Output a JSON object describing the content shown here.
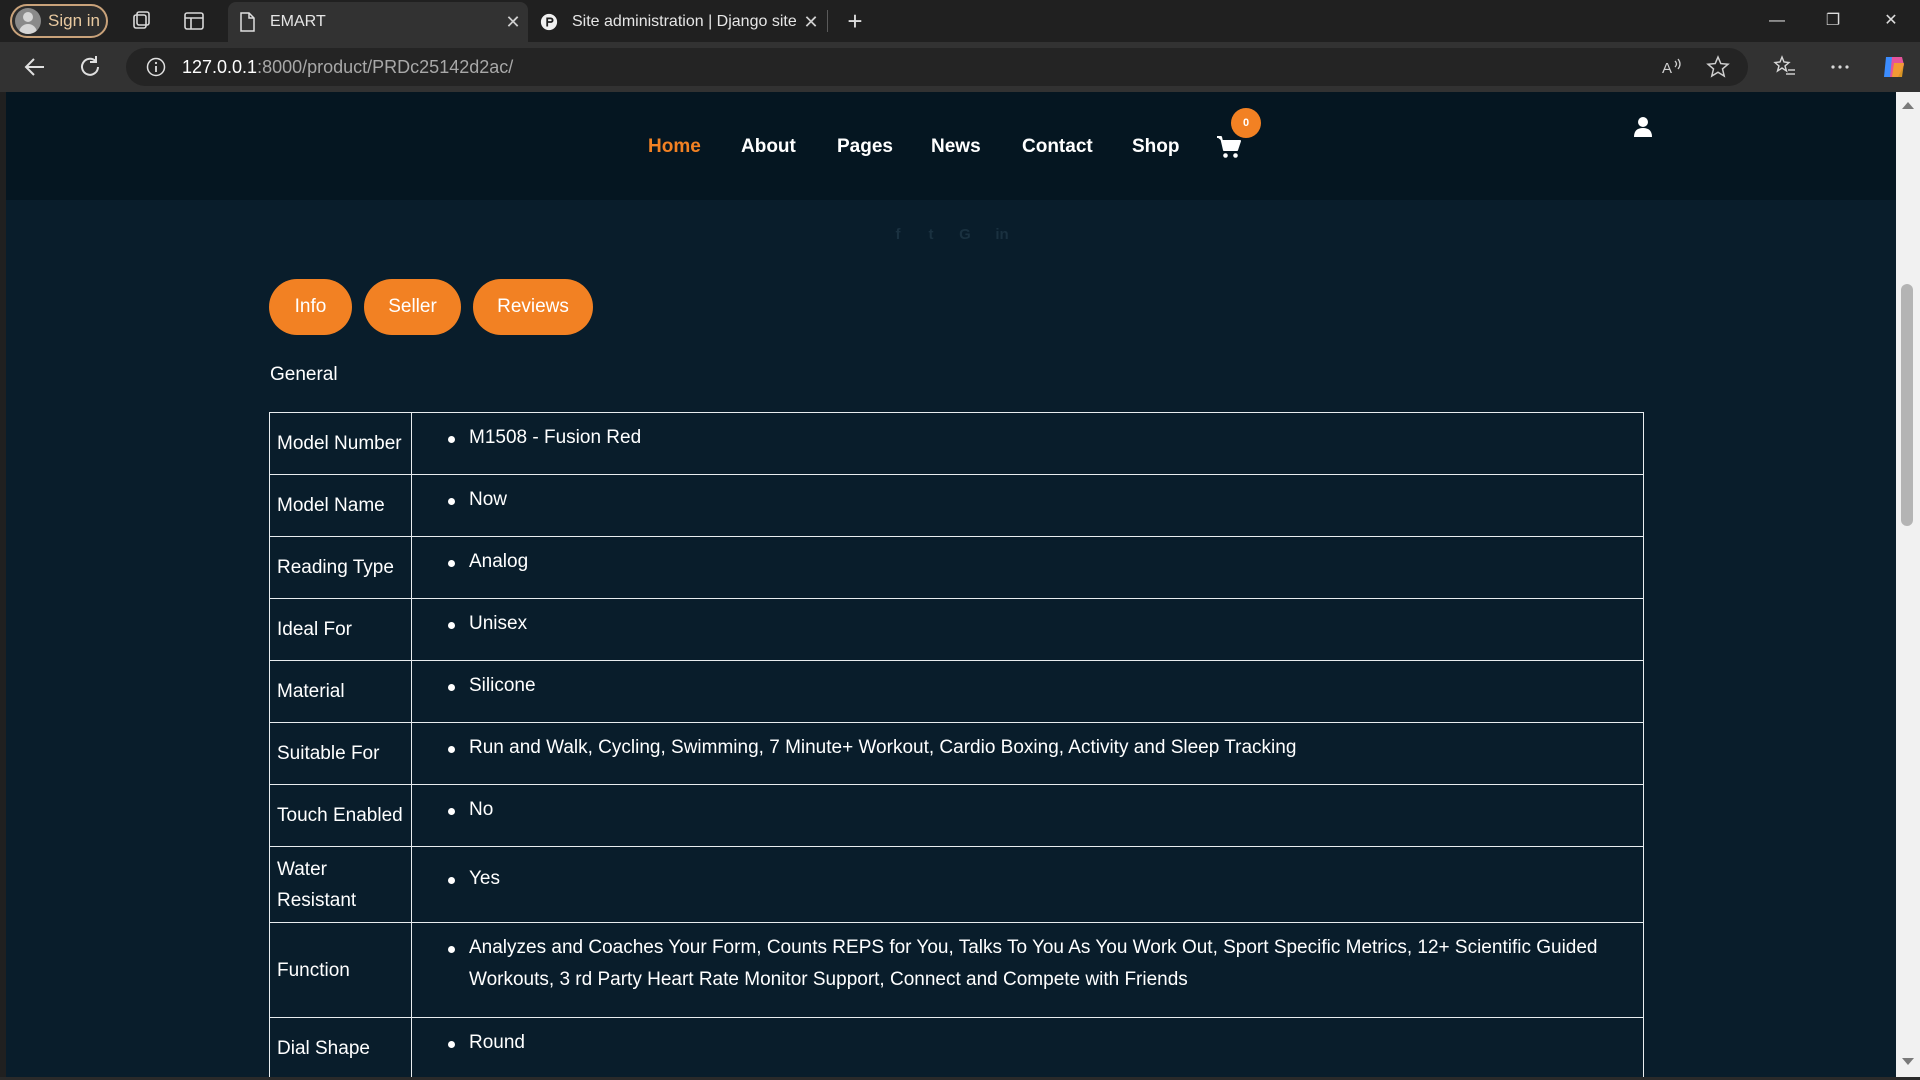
{
  "browser": {
    "signin_label": "Sign in",
    "tabs": [
      {
        "title": "EMART",
        "close": "✕"
      },
      {
        "title": "Site administration | Django site a",
        "close": "✕"
      }
    ],
    "new_tab": "+",
    "url_host": "127.0.0.1",
    "url_path": ":8000/product/PRDc25142d2ac/",
    "window_controls": {
      "minimize": "—",
      "restore": "❐",
      "close": "✕"
    }
  },
  "nav": {
    "items": [
      "Home",
      "About",
      "Pages",
      "News",
      "Contact",
      "Shop"
    ],
    "active": "Home",
    "cart_count": "0"
  },
  "social_icons": [
    "facebook-icon",
    "twitter-icon",
    "google-plus-icon",
    "linkedin-icon"
  ],
  "product_tabs": [
    "Info",
    "Seller",
    "Reviews"
  ],
  "section_title": "General",
  "specs": [
    {
      "key": "Model Number",
      "value": "M1508 - Fusion Red"
    },
    {
      "key": "Model Name",
      "value": "Now"
    },
    {
      "key": "Reading Type",
      "value": "Analog"
    },
    {
      "key": "Ideal For",
      "value": "Unisex"
    },
    {
      "key": "Material",
      "value": "Silicone"
    },
    {
      "key": "Suitable For",
      "value": "Run and Walk, Cycling, Swimming, 7 Minute+ Workout, Cardio Boxing, Activity and Sleep Tracking"
    },
    {
      "key": "Touch Enabled",
      "value": "No"
    },
    {
      "key": "Water Resistant",
      "value": "Yes"
    },
    {
      "key": "Function",
      "value": "Analyzes and Coaches Your Form, Counts REPS for You, Talks To You As You Work Out, Sport Specific Metrics, 12+ Scientific Guided Workouts, 3 rd Party Heart Rate Monitor Support, Connect and Compete with Friends"
    },
    {
      "key": "Dial Shape",
      "value": "Round"
    }
  ],
  "colors": {
    "accent": "#f28123",
    "page_bg": "#091d2b",
    "header_bg": "#051621"
  }
}
